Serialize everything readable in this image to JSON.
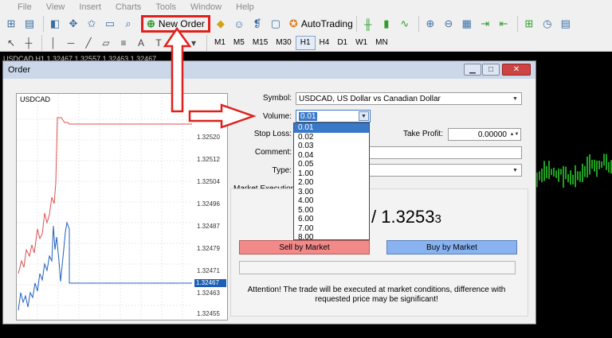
{
  "menu": [
    "File",
    "View",
    "Insert",
    "Charts",
    "Tools",
    "Window",
    "Help"
  ],
  "toolbar": {
    "new_order_label": "New Order",
    "autotrading_label": "AutoTrading"
  },
  "timeframes": [
    "M1",
    "M5",
    "M15",
    "M30",
    "H1",
    "H4",
    "D1",
    "W1",
    "MN"
  ],
  "active_timeframe": "H1",
  "background_chart": {
    "title": "USDCAD,H1  1.32467 1.32557 1.32463 1.32467"
  },
  "dialog": {
    "title": "Order",
    "mini_chart": {
      "symbol": "USDCAD",
      "ticks": [
        "1.32528",
        "1.32520",
        "1.32512",
        "1.32504",
        "1.32496",
        "1.32487",
        "1.32479",
        "1.32471",
        "1.32467",
        "1.32463",
        "1.32455"
      ],
      "current": "1.32467"
    },
    "form": {
      "symbol_label": "Symbol:",
      "symbol_value": "USDCAD, US Dollar vs Canadian Dollar",
      "volume_label": "Volume:",
      "volume_value": "0.01",
      "stoploss_label": "Stop Loss:",
      "takeprofit_label": "Take Profit:",
      "takeprofit_value": "0.00000",
      "comment_label": "Comment:",
      "type_label": "Type:",
      "market_execution": "Market Execution"
    },
    "volume_options": [
      "0.01",
      "0.02",
      "0.03",
      "0.04",
      "0.05",
      "1.00",
      "2.00",
      "3.00",
      "4.00",
      "5.00",
      "6.00",
      "7.00",
      "8.00"
    ],
    "price_display": "/ 1.3253",
    "price_small_digit": "3",
    "sell_label": "Sell by Market",
    "buy_label": "Buy by Market",
    "attention_line1": "Attention! The trade will be executed at market conditions, difference with",
    "attention_line2": "requested price may be significant!"
  },
  "colors": {
    "annotation_red": "#e0201c",
    "sell": "#f38a8a",
    "buy": "#89b3f0",
    "candle_green": "#2bd52b"
  }
}
